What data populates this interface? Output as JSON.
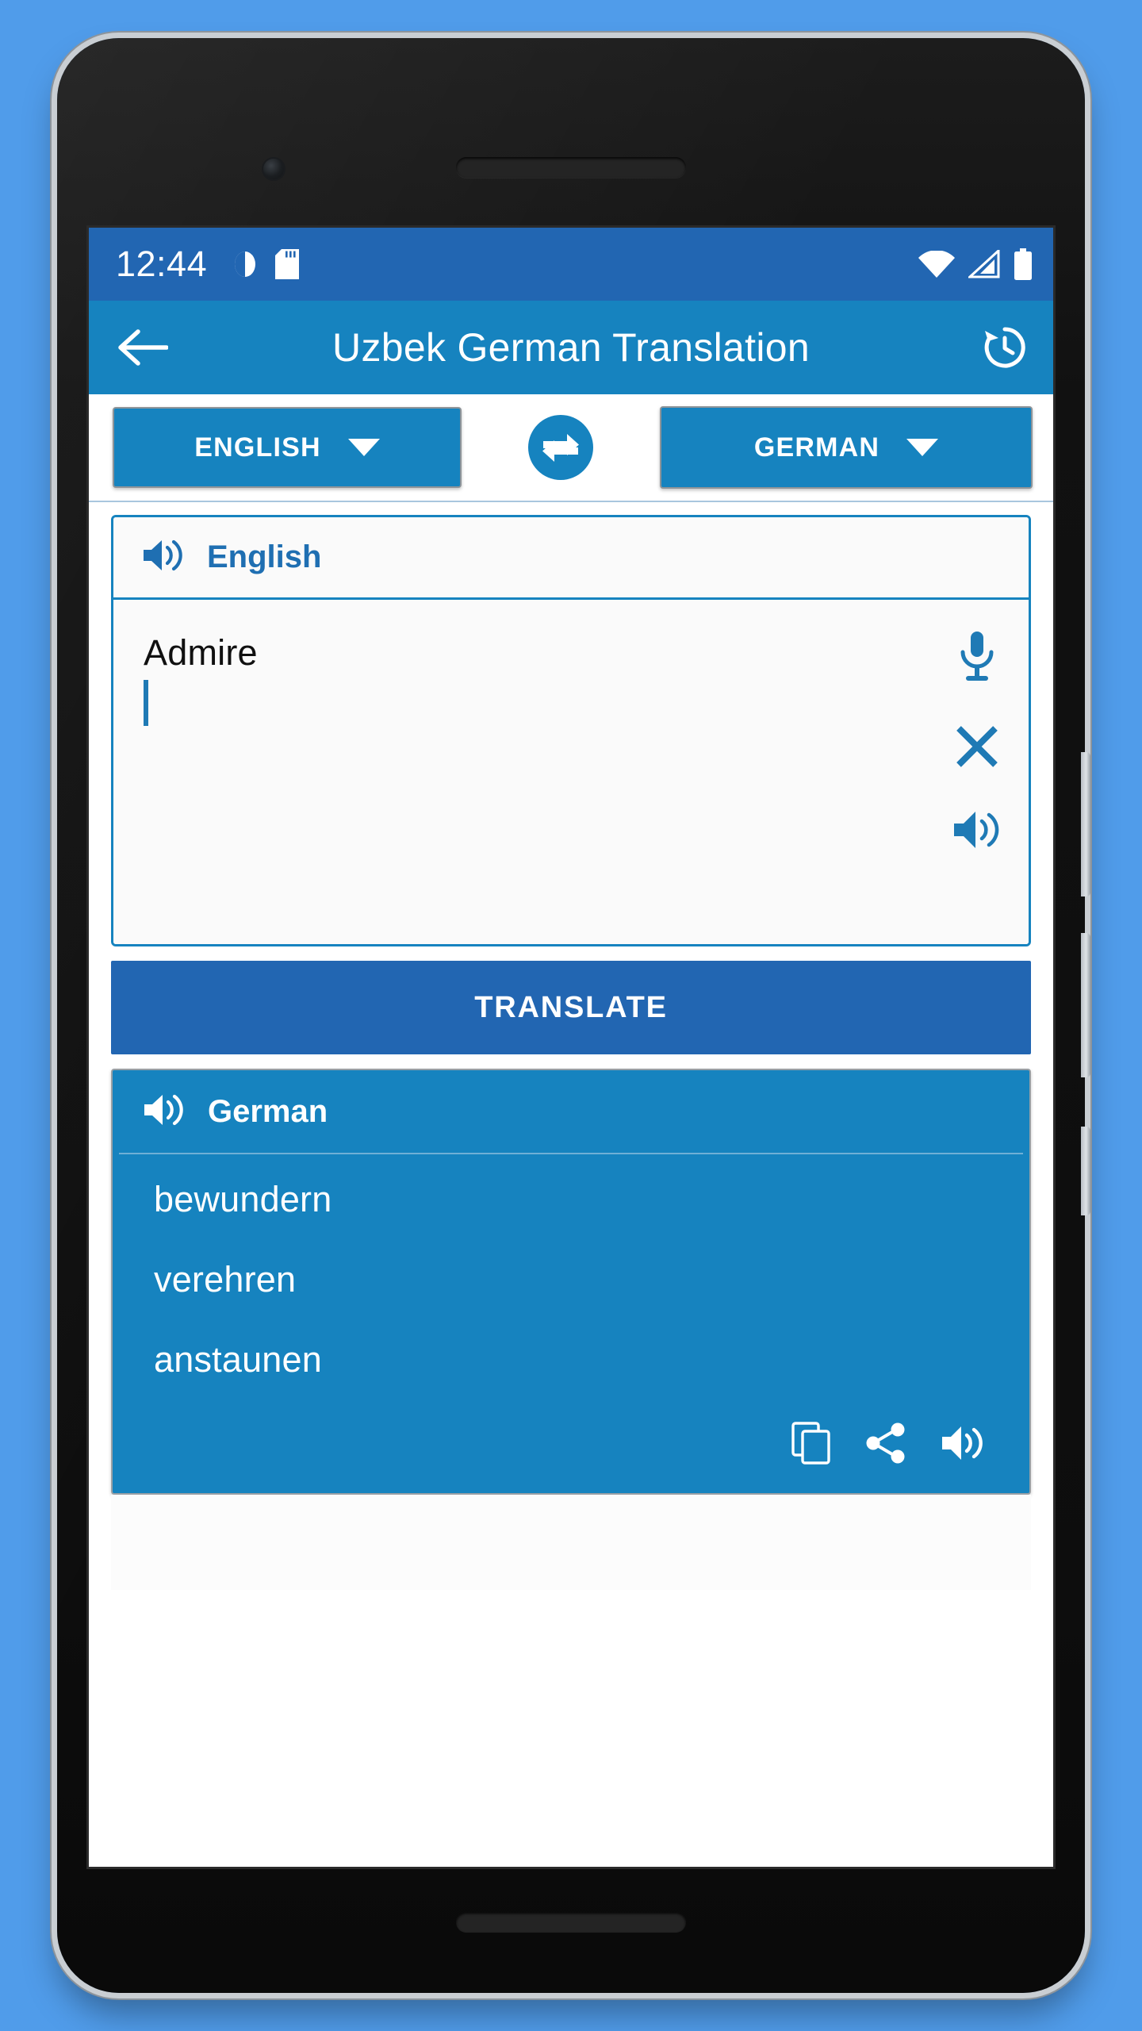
{
  "statusbar": {
    "time": "12:44",
    "icons": [
      "alarm-icon",
      "sd-card-icon",
      "wifi-icon",
      "cellular-signal-icon",
      "battery-icon"
    ]
  },
  "appbar": {
    "title": "Uzbek German Translation",
    "back_icon": "back-arrow-icon",
    "history_icon": "history-clock-icon"
  },
  "language_bar": {
    "source_language": "ENGLISH",
    "target_language": "GERMAN",
    "swap_icon": "swap-arrows-icon"
  },
  "source": {
    "header_label": "English",
    "speaker_icon": "speaker-icon",
    "text": "Admire",
    "actions": [
      {
        "name": "mic-button",
        "icon": "microphone-icon"
      },
      {
        "name": "clear-button",
        "icon": "close-x-icon"
      },
      {
        "name": "speak-source-button",
        "icon": "speaker-icon"
      }
    ]
  },
  "translate_button": {
    "label": "TRANSLATE"
  },
  "result": {
    "header_label": "German",
    "speaker_icon": "speaker-icon",
    "translations": [
      "bewundern",
      "verehren",
      "anstaunen"
    ],
    "actions": [
      {
        "name": "copy-button",
        "icon": "copy-icon"
      },
      {
        "name": "share-button",
        "icon": "share-icon"
      },
      {
        "name": "speak-result-button",
        "icon": "speaker-icon"
      }
    ]
  },
  "colors": {
    "background": "#509cea",
    "status_bar": "#2266b2",
    "app_bar": "#1683bf",
    "accent": "#1683bf",
    "translate_button": "#2266b2",
    "source_label": "#1f6fb2",
    "text_on_accent": "#ffffff"
  }
}
